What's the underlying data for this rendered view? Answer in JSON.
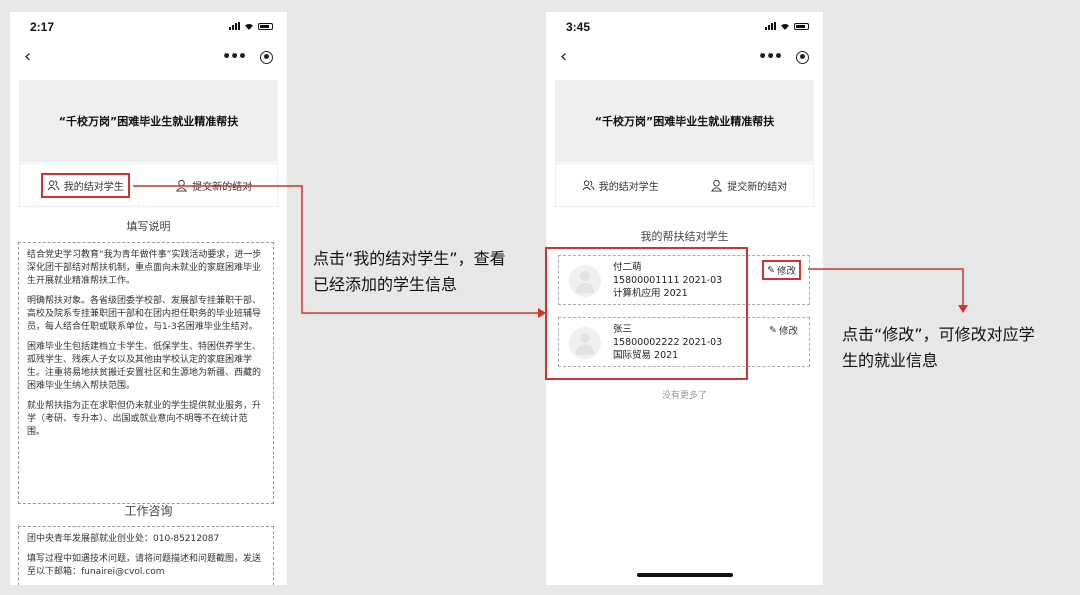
{
  "left_phone": {
    "status_time": "2:17",
    "banner_title": "“千校万岗”困难毕业生就业精准帮扶",
    "tab_mine": "我的结对学生",
    "tab_submit": "提交新的结对",
    "section_instructions": "填写说明",
    "instructions": [
      "结合党史学习教育“我为青年做件事”实践活动要求，进一步深化团干部结对帮扶机制，重点面向未就业的家庭困难毕业生开展就业精准帮扶工作。",
      "明确帮扶对象。各省级团委学校部、发展部专挂兼职干部、高校及院系专挂兼职团干部和在团内担任职务的毕业班辅导员，每人结合任职或联系单位，与1-3名困难毕业生结对。",
      "困难毕业生包括建档立卡学生、低保学生、特困供养学生、孤残学生、残疾人子女以及其他由学校认定的家庭困难学生。注重将易地扶贫搬迁安置社区和生源地为新疆、西藏的困难毕业生纳入帮扶范围。",
      "就业帮扶指为正在求职但仍未就业的学生提供就业服务，升学（考研、专升本）、出国或就业意向不明等不在统计范围。"
    ],
    "section_consult": "工作咨询",
    "consult_lines": [
      "团中央青年发展部就业创业处：010-85212087",
      "填写过程中如遇技术问题，请将问题描述和问题截图，发送至以下邮箱：funairei@cvol.com"
    ]
  },
  "right_phone": {
    "status_time": "3:45",
    "banner_title": "“千校万岗”困难毕业生就业精准帮扶",
    "tab_mine": "我的结对学生",
    "tab_submit": "提交新的结对",
    "section_title": "我的帮扶结对学生",
    "students": [
      {
        "name": "付二萌",
        "phone_year": "15800001111 2021-03",
        "major": "计算机应用 2021",
        "edit_label": "修改"
      },
      {
        "name": "张三",
        "phone_year": "15800002222 2021-03",
        "major": "国际贸易 2021",
        "edit_label": "修改"
      }
    ],
    "no_more": "没有更多了"
  },
  "annotations": {
    "tab_note_line1": "点击“我的结对学生”，查看",
    "tab_note_line2": "已经添加的学生信息",
    "edit_note_line1": "点击“修改”，可修改对应学",
    "edit_note_line2": "生的就业信息"
  },
  "colors": {
    "highlight": "#d0342c",
    "background": "#e7e7e7"
  }
}
